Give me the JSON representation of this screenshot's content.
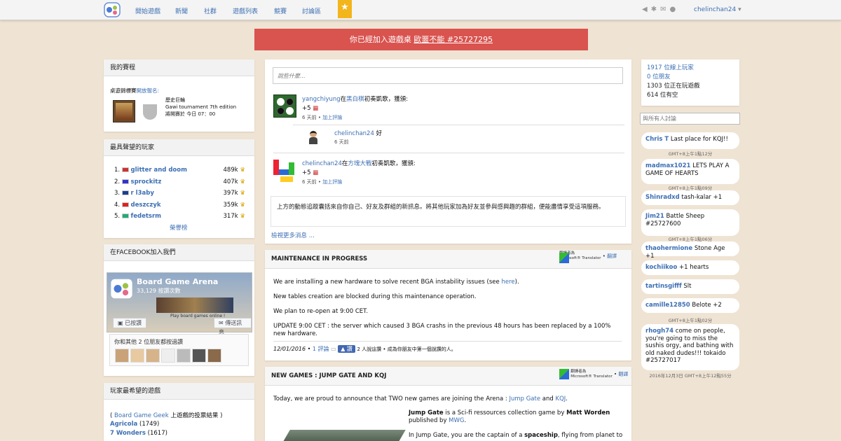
{
  "nav": {
    "items": [
      "開始遊戲",
      "新聞",
      "社群",
      "遊戲列表",
      "競賽",
      "討論區"
    ],
    "username": "chelinchan24"
  },
  "alert": {
    "text": "你已經加入遊戲桌",
    "link": "歐噩不能 #25727295"
  },
  "tournaments": {
    "title": "我的賽程",
    "subtitle": "桌遊錦標賽",
    "open": "開放報名:",
    "game": "歷史巨輪",
    "event": "Gawi tournament 7th edition",
    "start": "將開賽於 今日 07：00"
  },
  "players": {
    "title": "最具聲望的玩家",
    "ranking_link": "榮譽榜",
    "items": [
      {
        "rank": "1.",
        "name": "glitter and doom",
        "score": "489k",
        "flag": "#c33"
      },
      {
        "rank": "2.",
        "name": "sprockitz",
        "score": "407k",
        "flag": "#33c"
      },
      {
        "rank": "3.",
        "name": "r l3aby",
        "score": "397k",
        "flag": "#1a3e8f"
      },
      {
        "rank": "4.",
        "name": "deszczyk",
        "score": "359k",
        "flag": "#d22"
      },
      {
        "rank": "5.",
        "name": "fedetsrm",
        "score": "317k",
        "flag": "#2a7"
      }
    ]
  },
  "facebook": {
    "title": "在FACEBOOK加入我們",
    "page": "Board Game Arena",
    "likes": "33,129 按讚次數",
    "liked": "已按讚",
    "msg": "傳送訊息",
    "tagline": "Play board games online !",
    "friends": "你和其他 2 位朋友都按過讚"
  },
  "wishlist": {
    "title": "玩家最希望的遊戲",
    "source_pre": "( ",
    "source_link": "Board Game Geek",
    "source_post": " 上遊戲的投票結果 )",
    "items": [
      {
        "name": "Agricola",
        "n": "(1749)"
      },
      {
        "name": "7 Wonders",
        "n": "(1617)"
      }
    ]
  },
  "feed": {
    "placeholder": "說些什麼...",
    "entries": [
      {
        "user": "yangchiyung",
        "pre": "在",
        "game": "黑白棋",
        "post": "初奏凱歌，獲頒:",
        "plus": "+5",
        "time": "6 天前",
        "sep": "•",
        "comment": "加上評論"
      },
      {
        "user": "chelinchan24",
        "pre": "在",
        "game": "方塊大戰",
        "post": "初奏凱歌，獲頒:",
        "plus": "+5",
        "time": "6 天前",
        "sep": "•",
        "comment": "加上評論"
      }
    ],
    "reply": {
      "user": "chelinchan24",
      "text": " 好",
      "time": "6 天前"
    },
    "info": "上方的動態追蹤囊括來自你自己、好友及群組的新訊息。將其他玩家加為好友並參與感興趣的群組，便能盡情享受這項服務。",
    "more": "檢視更多消息 ..."
  },
  "news1": {
    "title": "MAINTENANCE IN PROGRESS",
    "p1a": "We are installing a new hardware to solve recent BGA instability issues (see ",
    "p1link": "here",
    "p1b": ").",
    "p2": "New tables creation are blocked during this maintenance operation.",
    "p3": "We plan to re-open at 9:00 CET.",
    "p4": "UPDATE 9:00 CET : the server which caused 3 BGA crashs in the previous 48 hours has been replaced by a 100% new hardware.",
    "date": "12/01/2016",
    "sep": "•",
    "comments": "1 評論",
    "like": "讚",
    "likes": "2 人說這讚 • 成為你朋友中第一個說讚的人。"
  },
  "news2": {
    "title": "NEW GAMES : JUMP GATE AND KQJ",
    "intro_a": "Today, we are proud to announce that TWO new games are joining the Arena : ",
    "g1": "Jump Gate",
    "and": " and ",
    "g2": "KQJ",
    "dot": ".",
    "d1a": "Jump Gate",
    "d1b": " is a Sci-fi ressources collection game by ",
    "d1c": "Matt Worden",
    "d1d": " published by ",
    "d1e": "MWG",
    "d1f": ".",
    "d2a": "In Jump Gate, you are the captain of a ",
    "d2b": "spaceship",
    "d2c": ", flying from planet to"
  },
  "translate": {
    "label1": "翻譯者為",
    "label2": "Microsoft® Translator",
    "sep": "•",
    "action": "翻譯"
  },
  "online": {
    "l1": "1917 位線上玩家",
    "l2": "0 位朋友",
    "l3": "1303 位正在玩遊戲",
    "l4": "614 位有空",
    "search_placeholder": "與所有人討論"
  },
  "chat": [
    {
      "user": "Chris T",
      "msg": " Last place for KQJ!!",
      "ts": "GMT+8上午1點12分"
    },
    {
      "user": "madmax1021",
      "msg": " LETS PLAY A GAME OF HEARTS",
      "ts": "GMT+8上午1點09分"
    },
    {
      "user": "Shinradxd",
      "msg": " tash-kalar +1",
      "ts": ""
    },
    {
      "user": "Jim21",
      "msg": " Battle Sheep #25727600",
      "ts": "GMT+8上午1點06分"
    },
    {
      "user": "thaohermione",
      "msg": " Stone Age +1",
      "ts": ""
    },
    {
      "user": "kochiikoo",
      "msg": " +1 hearts",
      "ts": ""
    },
    {
      "user": "tartinsgifff",
      "msg": " Slt",
      "ts": ""
    },
    {
      "user": "camille12850",
      "msg": " Belote +2",
      "ts": "GMT+8上午1點02分"
    },
    {
      "user": "rhogh74",
      "msg": " come on people, you're going to miss the sushis orgy, and bathing with old naked dudes!!! tokaido #25727017",
      "ts": "2016年12月3日 GMT+8上午12點55分"
    }
  ],
  "colors": {
    "accent": "#3c6fb3",
    "alert": "#d9534f",
    "background": "#efe3d3"
  }
}
